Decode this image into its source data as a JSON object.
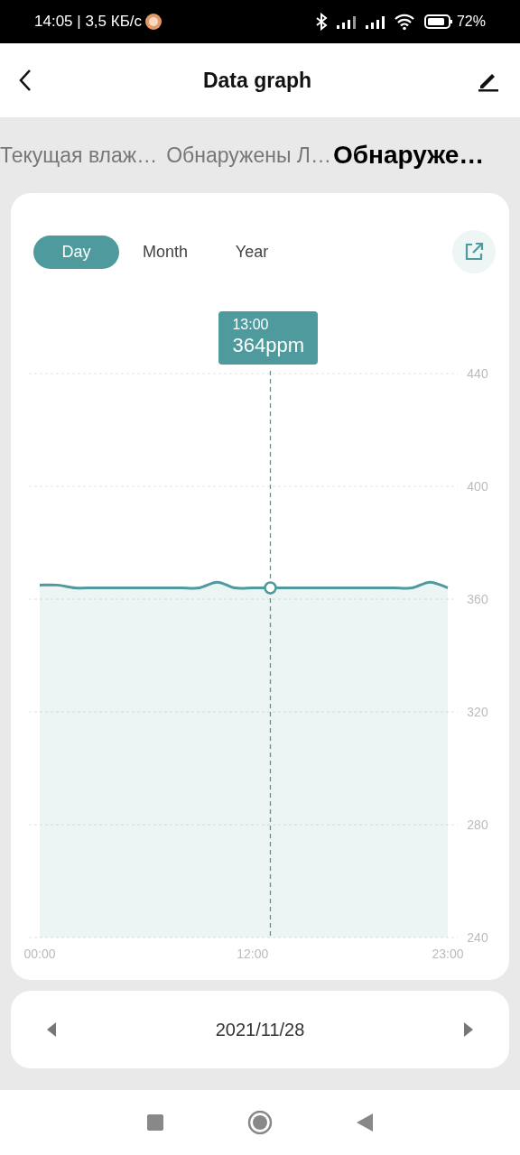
{
  "status_bar": {
    "time": "14:05 | 3,5 КБ/с",
    "battery": "72%"
  },
  "header": {
    "title": "Data graph"
  },
  "tabs": [
    {
      "label": "Текущая влаж…",
      "selected": false
    },
    {
      "label": "Обнаружены Л…",
      "selected": false
    },
    {
      "label": "Обнаруже…",
      "selected": true
    }
  ],
  "range_tabs": [
    {
      "label": "Day",
      "selected": true
    },
    {
      "label": "Month",
      "selected": false
    },
    {
      "label": "Year",
      "selected": false
    }
  ],
  "chart_data": {
    "type": "area",
    "x": [
      0,
      1,
      2,
      3,
      4,
      5,
      6,
      7,
      8,
      9,
      10,
      11,
      12,
      13,
      14,
      15,
      16,
      17,
      18,
      19,
      20,
      21,
      22,
      23
    ],
    "grid": true,
    "series": [
      {
        "color": "#4e9a9c",
        "values": [
          365,
          365,
          364,
          364,
          364,
          364,
          364,
          364,
          364,
          364,
          366,
          364,
          364,
          364,
          364,
          364,
          364,
          364,
          364,
          364,
          364,
          364,
          366,
          364
        ]
      }
    ],
    "xlim": [
      0,
      23
    ],
    "ylim": [
      240,
      440
    ],
    "xticks": [
      {
        "value": 0,
        "label": "00:00"
      },
      {
        "value": 12,
        "label": "12:00"
      },
      {
        "value": 23,
        "label": "23:00"
      }
    ],
    "yticks": [
      240,
      280,
      320,
      360,
      400,
      440
    ],
    "ref_lines": [
      {
        "axis": "x",
        "value": 13
      }
    ]
  },
  "tooltip": {
    "time": "13:00",
    "value": "364ppm"
  },
  "date_nav": {
    "date": "2021/11/28"
  }
}
